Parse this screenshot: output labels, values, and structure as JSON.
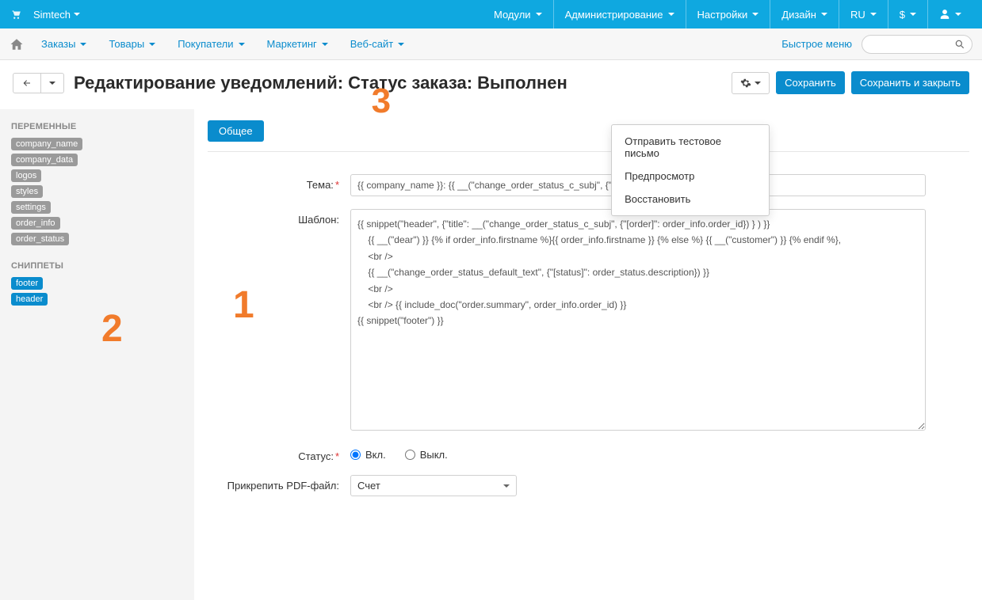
{
  "topbar": {
    "brand": "Simtech",
    "menu": [
      {
        "label": "Модули"
      },
      {
        "label": "Администрирование"
      },
      {
        "label": "Настройки"
      },
      {
        "label": "Дизайн"
      },
      {
        "label": "RU"
      },
      {
        "label": "$"
      }
    ]
  },
  "menubar": {
    "items": [
      {
        "label": "Заказы"
      },
      {
        "label": "Товары"
      },
      {
        "label": "Покупатели"
      },
      {
        "label": "Маркетинг"
      },
      {
        "label": "Веб-сайт"
      }
    ],
    "quick_menu": "Быстрое меню"
  },
  "page": {
    "title": "Редактирование уведомлений: Статус заказа: Выполнен",
    "save": "Сохранить",
    "save_close": "Сохранить и закрыть"
  },
  "gear_menu": {
    "items": [
      "Отправить тестовое письмо",
      "Предпросмотр",
      "Восстановить"
    ]
  },
  "sidebar": {
    "vars_title": "ПЕРЕМЕННЫЕ",
    "vars": [
      "company_name",
      "company_data",
      "logos",
      "styles",
      "settings",
      "order_info",
      "order_status"
    ],
    "snip_title": "СНИППЕТЫ",
    "snippets": [
      "footer",
      "header"
    ]
  },
  "annotations": {
    "n1": "1",
    "n2": "2",
    "n3": "3"
  },
  "tabs": {
    "general": "Общее"
  },
  "form": {
    "subject_label": "Тема:",
    "subject_value": "{{ company_name }}: {{ __(\"change_order_status_c_subj\", {\"[order]\": order_info.order_id}) }}",
    "template_label": "Шаблон:",
    "template_value": "{{ snippet(\"header\", {\"title\": __(\"change_order_status_c_subj\", {\"[order]\": order_info.order_id}) } ) }}\n    {{ __(\"dear\") }} {% if order_info.firstname %}{{ order_info.firstname }} {% else %} {{ __(\"customer\") }} {% endif %},\n    <br />\n    {{ __(\"change_order_status_default_text\", {\"[status]\": order_status.description}) }}\n    <br />\n    <br /> {{ include_doc(\"order.summary\", order_info.order_id) }}\n{{ snippet(\"footer\") }}",
    "status_label": "Статус:",
    "status_on": "Вкл.",
    "status_off": "Выкл.",
    "attach_label": "Прикрепить PDF-файл:",
    "attach_value": "Счет"
  }
}
